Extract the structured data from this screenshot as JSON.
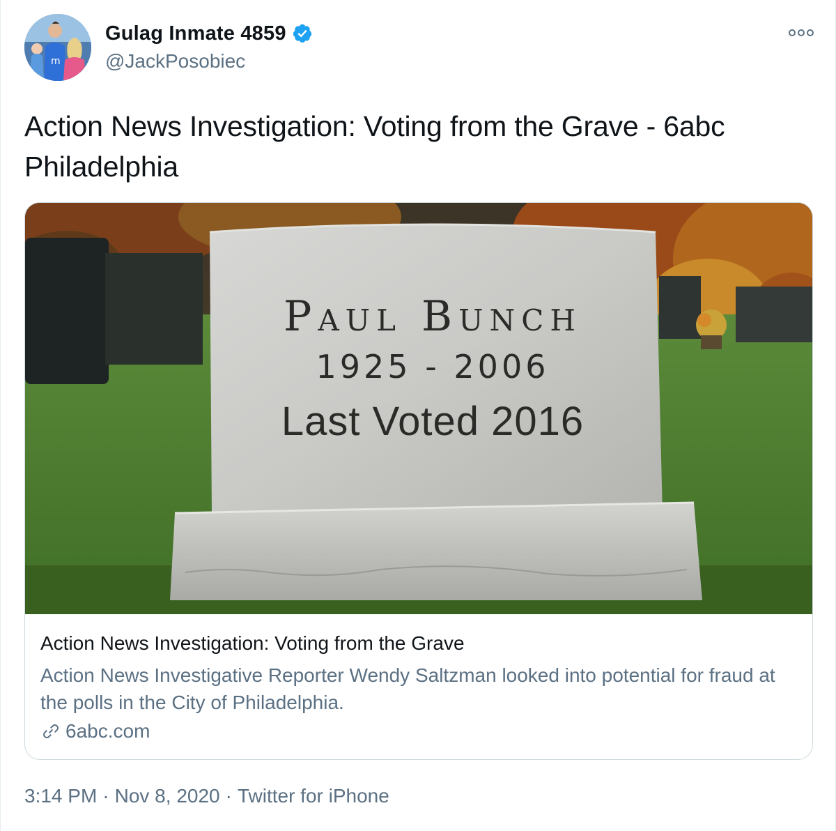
{
  "author": {
    "display_name": "Gulag Inmate 4859",
    "handle": "@JackPosobiec",
    "verified": true,
    "avatar_icon": "profile-photo"
  },
  "tweet": {
    "text": "Action News Investigation: Voting from the Grave - 6abc Philadelphia"
  },
  "card": {
    "image": {
      "description_icon": "tombstone-photo",
      "stone_name": "Paul Bunch",
      "stone_dates": "1925 - 2006",
      "stone_voted": "Last Voted 2016"
    },
    "title": "Action News Investigation: Voting from the Grave",
    "description": "Action News Investigative Reporter Wendy Saltzman looked into potential for fraud at the polls in the City of Philadelphia.",
    "domain": "6abc.com",
    "link_icon": "link-icon"
  },
  "meta": {
    "time": "3:14 PM",
    "separator": "·",
    "date": "Nov 8, 2020",
    "source": "Twitter for iPhone"
  },
  "colors": {
    "verified_blue": "#1da1f2",
    "secondary_text": "#5b7083",
    "border": "#cfd9de"
  }
}
